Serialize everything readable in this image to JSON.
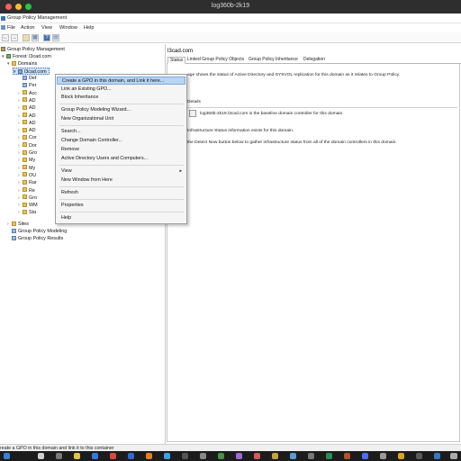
{
  "mac": {
    "title": "log360b-2k19"
  },
  "app": {
    "title": "Group Policy Management"
  },
  "menubar": [
    "File",
    "Action",
    "View",
    "Window",
    "Help"
  ],
  "toolbar": {
    "icons": [
      "back-icon",
      "forward-icon",
      "folder-icon",
      "grid-icon",
      "help-icon",
      "panel-icon"
    ]
  },
  "tree": {
    "root": "Group Policy Management",
    "forest": "Forest: l3cad.com",
    "domains": "Domains",
    "domain": "l3cad.com",
    "children": [
      "Def",
      "Per",
      "Acc",
      "AD",
      "AD",
      "AD",
      "AD",
      "AD",
      "Cor",
      "Dor",
      "Gro",
      "My",
      "My",
      "OU",
      "Rar",
      "Re",
      "Gro",
      "WM",
      "Sta"
    ],
    "sites": "Sites",
    "modeling": "Group Policy Modeling",
    "results": "Group Policy Results"
  },
  "right": {
    "title": "l3cad.com",
    "tabs": [
      "Status",
      "Linked Group Policy Objects",
      "Group Policy Inheritance",
      "Delegation"
    ],
    "line1": "age shows the status of Active Directory and SYSVOL replication for this domain as it relates to Group Policy.",
    "details": "Details",
    "baseline": "log360b-2k19.l3cad.com is the baseline domain controller for this domain.",
    "infra": "Infrastructure Status information exists for this domain.",
    "detect": "the Detect Now button below to gather infrastructure status from all of the domain controllers in this domain."
  },
  "context_menu": {
    "items": [
      "Create a GPO in this domain, and Link it here...",
      "Link an Existing GPO...",
      "Block Inheritance",
      "Group Policy Modeling Wizard...",
      "New Organizational Unit",
      "Search...",
      "Change Domain Controller...",
      "Remove",
      "Active Directory Users and Computers...",
      "View",
      "New Window from Here",
      "Refresh",
      "Properties",
      "Help"
    ],
    "highlighted_index": 0
  },
  "status": {
    "text": "reate a GPO in this domain and link it to this container"
  },
  "colors": {
    "highlight": "#b9d5f3",
    "selection": "#cde0f7",
    "mac_bar": "#2e2e2e",
    "taskbar": "#1c1c1c"
  }
}
